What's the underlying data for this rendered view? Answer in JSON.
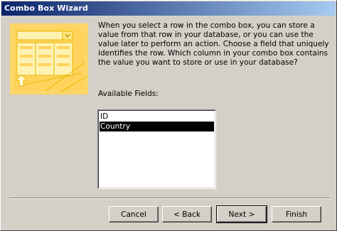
{
  "window": {
    "title": "Combo Box Wizard",
    "accent_colors": {
      "title_start": "#0a246a",
      "title_end": "#a6caf0",
      "illustration": "#ffd35c"
    }
  },
  "content": {
    "instructions": "When you select a row in the combo box, you can store a value from that row in your database, or you can use the value later to perform an action.  Choose a field that uniquely identifies the row. Which column in your combo box contains the value you want to store or use in your database?",
    "fields_label": "Available Fields:",
    "fields": [
      {
        "label": "ID",
        "selected": false
      },
      {
        "label": "Country",
        "selected": true
      }
    ]
  },
  "buttons": {
    "cancel": "Cancel",
    "back": "< Back",
    "next": "Next >",
    "finish": "Finish"
  }
}
